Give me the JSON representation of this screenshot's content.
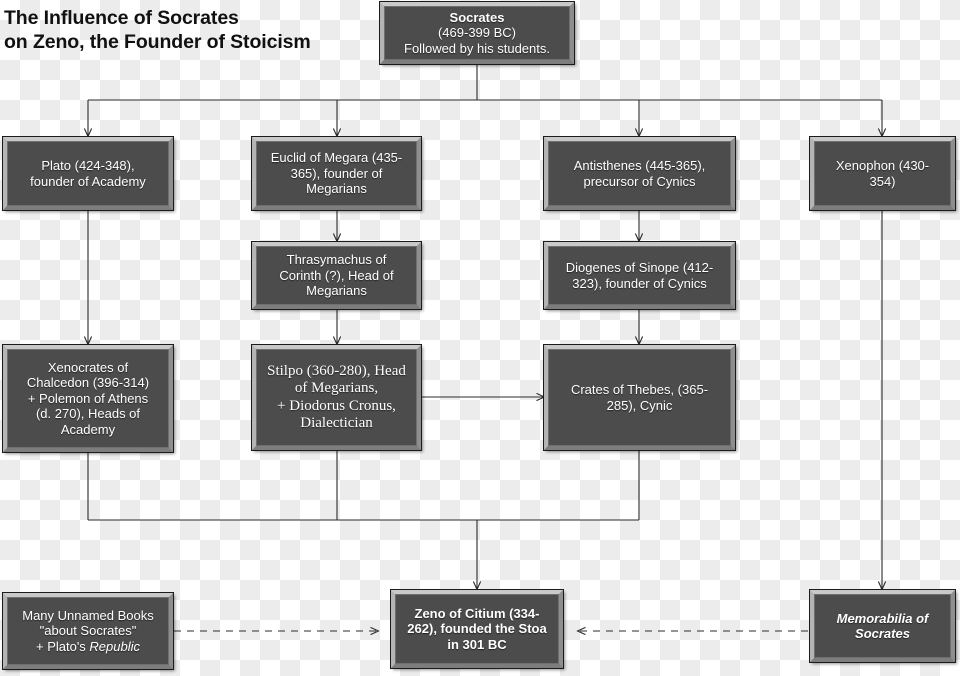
{
  "title": {
    "line1": "The Influence of Socrates",
    "line2": "on Zeno, the Founder of Stoicism"
  },
  "colors": {
    "node_fill": "#4c4c4c",
    "node_bevel_light": "#c9c9c9",
    "node_bevel_dark": "#7d7d7d",
    "node_outline": "#1b1b1b",
    "node_text": "#ffffff",
    "wire": "#2b2b2b",
    "title_text": "#111111",
    "background_checker": "#ececec"
  },
  "nodes": {
    "socrates": {
      "head": "Socrates",
      "line2": "(469-399 BC)",
      "line3": "Followed by his students."
    },
    "plato": {
      "line1": "Plato (424-348),",
      "line2": "founder of Academy"
    },
    "euclid": {
      "line1": "Euclid of Megara (435-",
      "line2": "365), founder of",
      "line3": "Megarians"
    },
    "antisthenes": {
      "line1": "Antisthenes (445-365),",
      "line2": "precursor of Cynics"
    },
    "xenophon": {
      "line1": "Xenophon (430-",
      "line2": "354)"
    },
    "thrasymachus": {
      "line1": "Thrasymachus of",
      "line2": "Corinth (?), Head of",
      "line3": "Megarians"
    },
    "diogenes": {
      "line1": "Diogenes of Sinope (412-",
      "line2": "323), founder of Cynics"
    },
    "xenocrates": {
      "line1": "Xenocrates of",
      "line2": "Chalcedon (396-314)",
      "line3": "+ Polemon of Athens",
      "line4": "(d. 270), Heads of",
      "line5": "Academy"
    },
    "stilpo": {
      "line1": "Stilpo (360-280), Head",
      "line2": "of Megarians,",
      "line3": "+ Diodorus Cronus,",
      "line4": "Dialectician"
    },
    "crates": {
      "line1": "Crates of Thebes, (365-",
      "line2": "285), Cynic"
    },
    "books": {
      "line1": "Many Unnamed Books",
      "line2": "\"about Socrates\"",
      "line3_prefix": "+ Plato's ",
      "line3_italic": "Republic"
    },
    "zeno": {
      "line1": "Zeno of Citium (334-",
      "line2": "262), founded the Stoa",
      "line3": "in 301 BC"
    },
    "memorabilia": {
      "line1": "Memorabilia of",
      "line2": "Socrates"
    }
  },
  "edges": [
    {
      "from": "socrates",
      "to": "plato",
      "style": "solid"
    },
    {
      "from": "socrates",
      "to": "euclid",
      "style": "solid"
    },
    {
      "from": "socrates",
      "to": "antisthenes",
      "style": "solid"
    },
    {
      "from": "socrates",
      "to": "xenophon",
      "style": "solid"
    },
    {
      "from": "plato",
      "to": "xenocrates",
      "style": "solid"
    },
    {
      "from": "euclid",
      "to": "thrasymachus",
      "style": "solid"
    },
    {
      "from": "antisthenes",
      "to": "diogenes",
      "style": "solid"
    },
    {
      "from": "thrasymachus",
      "to": "stilpo",
      "style": "solid"
    },
    {
      "from": "diogenes",
      "to": "crates",
      "style": "solid"
    },
    {
      "from": "stilpo",
      "to": "crates",
      "style": "solid"
    },
    {
      "from": "xenocrates",
      "to": "zeno",
      "style": "solid"
    },
    {
      "from": "stilpo",
      "to": "zeno",
      "style": "solid"
    },
    {
      "from": "crates",
      "to": "zeno",
      "style": "solid"
    },
    {
      "from": "xenophon",
      "to": "memorabilia",
      "style": "solid"
    },
    {
      "from": "books",
      "to": "zeno",
      "style": "dashed"
    },
    {
      "from": "memorabilia",
      "to": "zeno",
      "style": "dashed"
    }
  ]
}
